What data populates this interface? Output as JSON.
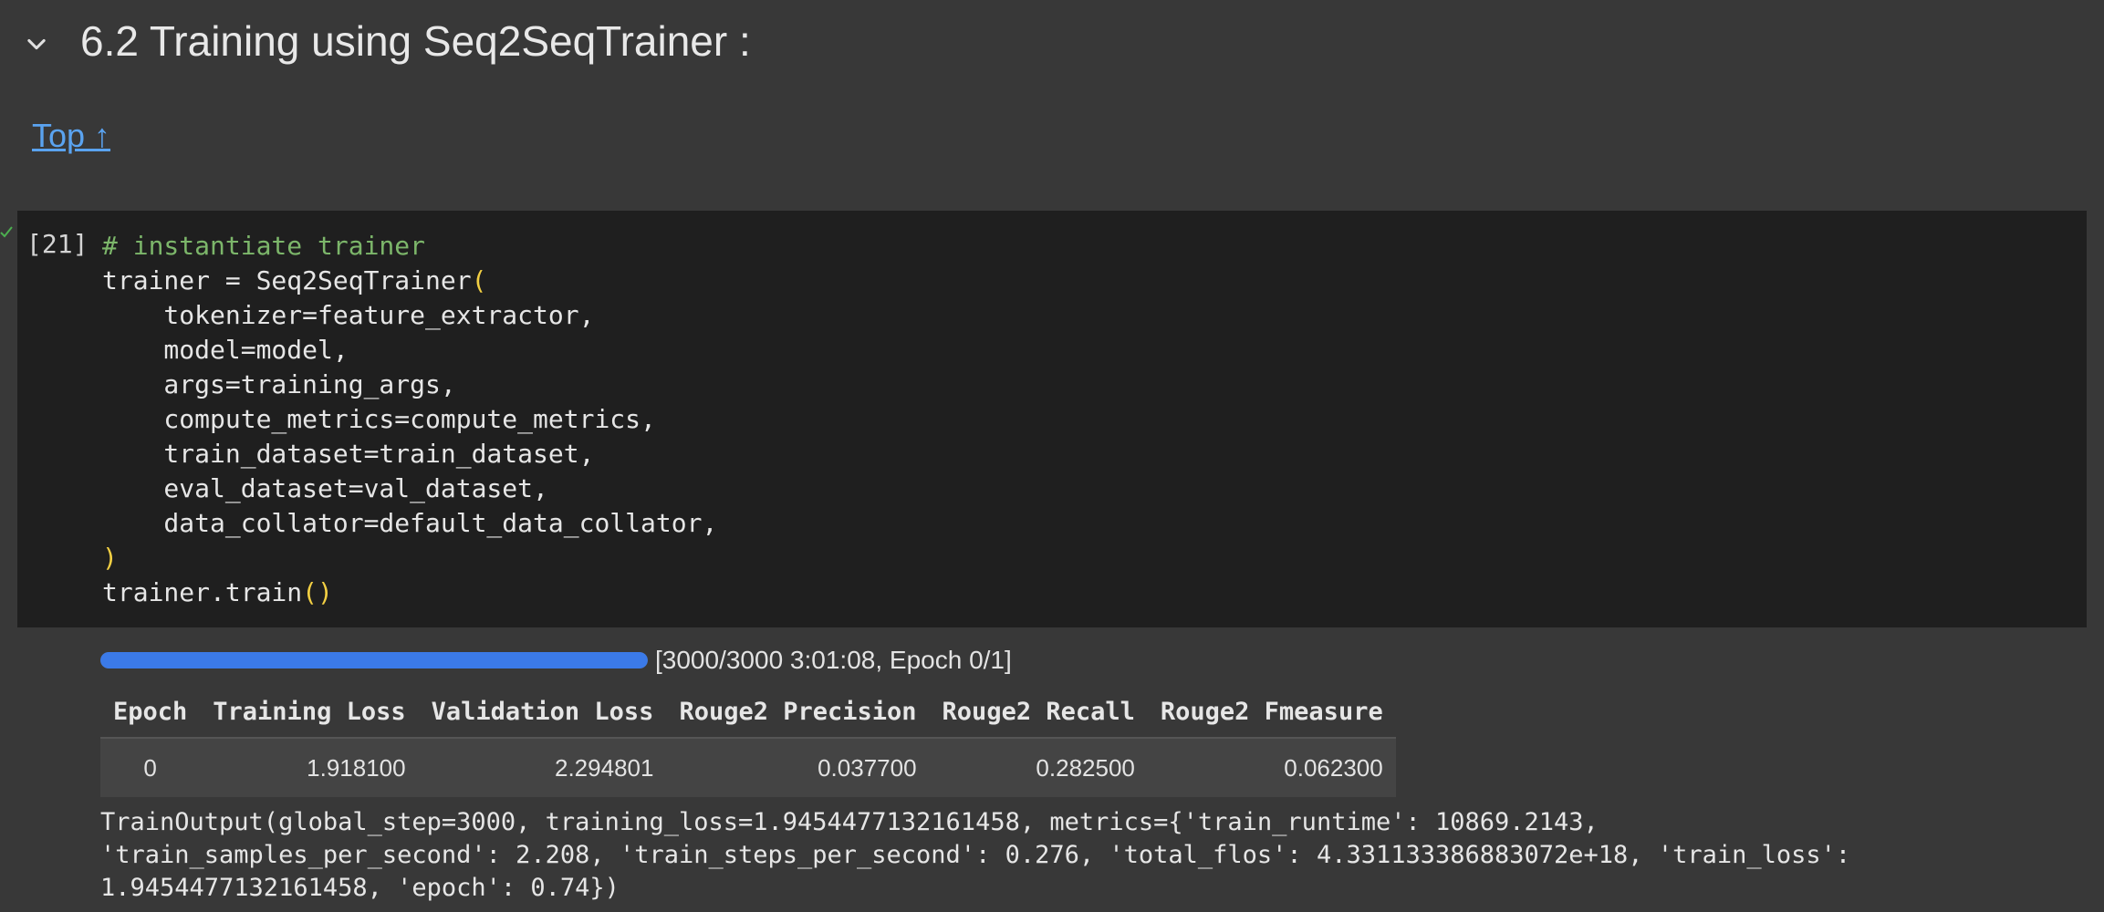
{
  "section": {
    "title": "6.2 Training using Seq2SeqTrainer :",
    "top_link": "Top ↑"
  },
  "cell": {
    "execution_count": "[21]",
    "code_lines": [
      {
        "text": "# instantiate trainer",
        "kind": "comment"
      },
      {
        "text": "trainer = Seq2SeqTrainer",
        "paren": "("
      },
      {
        "text": "    tokenizer=feature_extractor,"
      },
      {
        "text": "    model=model,"
      },
      {
        "text": "    args=training_args,"
      },
      {
        "text": "    compute_metrics=compute_metrics,"
      },
      {
        "text": "    train_dataset=train_dataset,"
      },
      {
        "text": "    eval_dataset=val_dataset,"
      },
      {
        "text": "    data_collator=default_data_collator,"
      },
      {
        "text": "",
        "paren": ")"
      },
      {
        "text": "trainer.train",
        "paren": "()"
      }
    ]
  },
  "output": {
    "progress": {
      "fraction": 1.0,
      "label": "[3000/3000 3:01:08, Epoch 0/1]"
    },
    "table": {
      "headers": [
        "Epoch",
        "Training Loss",
        "Validation Loss",
        "Rouge2 Precision",
        "Rouge2 Recall",
        "Rouge2 Fmeasure"
      ],
      "rows": [
        [
          "0",
          "1.918100",
          "2.294801",
          "0.037700",
          "0.282500",
          "0.062300"
        ]
      ]
    },
    "train_output_lines": [
      "TrainOutput(global_step=3000, training_loss=1.9454477132161458, metrics={'train_runtime': 10869.2143,",
      "'train_samples_per_second': 2.208, 'train_steps_per_second': 0.276, 'total_flos': 4.331133386883072e+18, 'train_loss':",
      "1.9454477132161458, 'epoch': 0.74})"
    ]
  },
  "colors": {
    "background": "#383838",
    "cell_background": "#1f1f1f",
    "link": "#5aa3f0",
    "progress_fill": "#3b7ae8",
    "comment": "#7cb66a",
    "paren": "#f2cf43",
    "success_check": "#4caf50"
  },
  "icons": {
    "collapse": "chevron-down-icon",
    "status": "check-icon"
  }
}
